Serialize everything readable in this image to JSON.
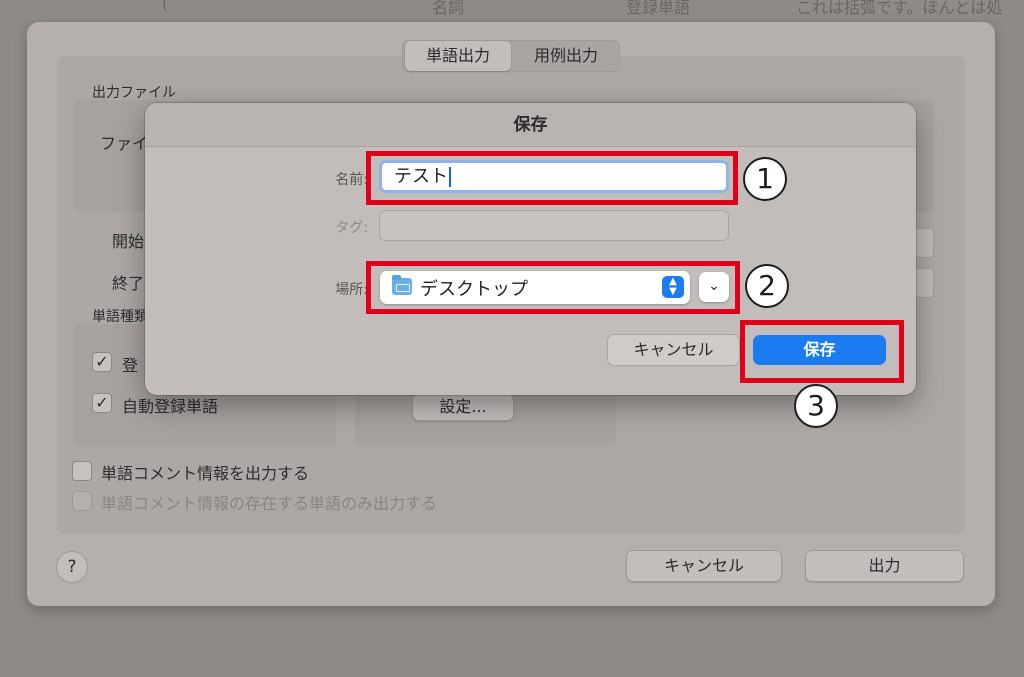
{
  "background_header": {
    "col1": "(",
    "col2": "名詞",
    "col3": "登録単語",
    "col4": "これは括弧です。ほんとは処"
  },
  "export_dialog": {
    "tabs": [
      "単語出力",
      "用例出力"
    ],
    "output_file_label": "出力ファイル",
    "file_label_partial": "ファイ",
    "start_label_partial": "開始",
    "end_label_partial": "終了",
    "word_type_label_partial": "単語種類",
    "registered_checkbox_partial": "登",
    "auto_registered_label": "自動登録単語",
    "settings_button": "設定...",
    "comment_output_label": "単語コメント情報を出力する",
    "comment_only_label": "単語コメント情報の存在する単語のみ出力する",
    "help_label": "?",
    "cancel_label": "キャンセル",
    "output_label": "出力",
    "checkmark": "✓"
  },
  "save_dialog": {
    "title": "保存",
    "name_label": "名前:",
    "name_value": "テスト",
    "tag_label": "タグ:",
    "location_label": "場所:",
    "location_value": "デスクトップ",
    "cancel_label": "キャンセル",
    "save_label": "保存"
  },
  "callouts": [
    "1",
    "2",
    "3"
  ],
  "colors": {
    "highlight": "#e0001a",
    "accent_blue": "#1a7cf0"
  }
}
